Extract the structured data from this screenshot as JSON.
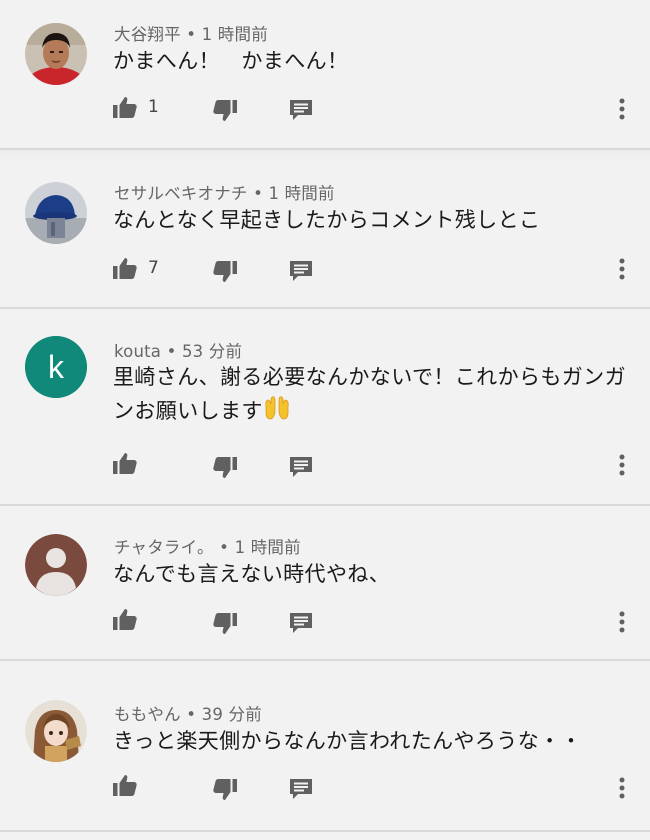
{
  "comments": [
    {
      "author": "大谷翔平",
      "time": "1 時間前",
      "text": "かまへん！　かまへん！",
      "likes": "1",
      "avatar": "photo-person-red-shirt-icon"
    },
    {
      "author": "セサルベキオナチ",
      "time": "1 時間前",
      "text": "なんとなく早起きしたからコメント残しとこ",
      "likes": "7",
      "avatar": "photo-blue-cap-icon"
    },
    {
      "author": "kouta",
      "time": "53 分前",
      "text": "里崎さん、謝る必要なんかないで！これからもガンガンお願いします",
      "likes": "",
      "avatar_letter": "k",
      "avatar_color": "#10897a",
      "emoji": "raised-hands-emoji"
    },
    {
      "author": "チャタライ。",
      "time": "1 時間前",
      "text": "なんでも言えない時代やね、",
      "likes": "",
      "avatar": "default-person-icon",
      "avatar_color": "#7b4a3f"
    },
    {
      "author": "ももやん",
      "time": "39 分前",
      "text": "きっと楽天側からなんか言われたんやろうな・・",
      "likes": "",
      "avatar": "photo-anime-girl-icon"
    }
  ],
  "separator": "•",
  "colors": {
    "background": "#f2f2f2",
    "icon_gray": "#606060",
    "meta_gray": "#666666",
    "divider": "#dadada"
  }
}
